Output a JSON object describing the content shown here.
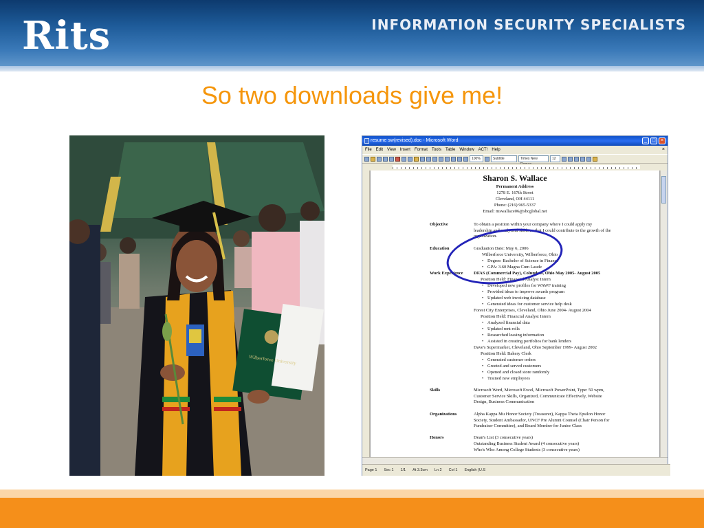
{
  "header": {
    "logo": "Rits",
    "tagline": "INFORMATION SECURITY SPECIALISTS"
  },
  "slide": {
    "title": "So two downloads give me!"
  },
  "photo": {
    "diploma_text": "Wilberforce University"
  },
  "word": {
    "title": "resume sw(revised).doc - Microsoft Word",
    "menu": [
      "File",
      "Edit",
      "View",
      "Insert",
      "Format",
      "Tools",
      "Table",
      "Window",
      "ACT!",
      "Help"
    ],
    "toolbar": {
      "zoom": "100%",
      "style": "Subtitle",
      "font": "Times New Roman",
      "size": "12"
    },
    "status": {
      "page": "Page 1",
      "sec": "Sec 1",
      "pages": "1/1",
      "at": "At 3.3cm",
      "ln": "Ln 2",
      "col": "Col 1",
      "lang": "English (U.S"
    },
    "document": {
      "name": "Sharon S. Wallace",
      "permanent": "Permanent Address",
      "street": "1278 E. 167th Street",
      "city": "Cleveland, OH 44111",
      "phone": "Phone:  (216) 965-5337",
      "email": "Email:  mswallace06@sbcglobal.net",
      "objective_label": "Objective",
      "objective_text": "To obtain a position within your company where I could apply my leadership and analytical skills so that I could contribute to the growth of the organization.",
      "education_label": "Education",
      "education_date": "Graduation Date:  May 6, 2006",
      "education_school": "Wilberforce University, Wilberforce, Ohio",
      "education_bullets": [
        "Degree:  Bachelor of Science in Finance",
        "GPA:  3.60 Magna Cum Laude"
      ],
      "work_label": "Work Experience",
      "job1_header": "DFAS (Commercial Pay), Columbus, Ohio        May 2005- August 2005",
      "job1_position": "Position Held:  Financial Analyst Intern",
      "job1_bullets": [
        "Developed new profiles for WAWF training",
        "Provided ideas to improve awards program",
        "Updated web invoicing database",
        "Generated ideas for customer service help desk"
      ],
      "job2_header": "Forest City Enterprises, Cleveland, Ohio        June 2004- August 2004",
      "job2_position": "Position Held:  Financial Analyst Intern",
      "job2_bullets": [
        "Analyzed financial data",
        "Updated rent rolls",
        "Researched leasing information",
        "Assisted in creating portfolios for bank lenders"
      ],
      "job3_header": "Dave's Supermarket, Cleveland, Ohio     September 1999- August 2002",
      "job3_position": "Position Held:  Bakery Clerk",
      "job3_bullets": [
        "Generated customer orders",
        "Greeted and served customers",
        "Opened and closed store randomly",
        "Trained new employees"
      ],
      "skills_label": "Skills",
      "skills_text": "Microsoft Word, Microsoft Excel, Microsoft PowerPoint, Type: 50 wpm, Customer Service Skills, Organized, Communicate Effectively, Website Design, Business Communication",
      "orgs_label": "Organizations",
      "orgs_text": "Alpha Kappa Mu Honor Society (Treasurer), Kappa Theta Epsilon Honor Society, Student Ambassador, UNCF Pre Alumni Counsel (Chair Person for Fundraiser Committee), and Board Member for Junior Class",
      "honors_label": "Honors",
      "honors_lines": [
        "Dean's List (3 consecutive years)",
        "Outstanding Business Student Award (4 consecutive years)",
        "Who's Who Among College Students (3 consecutive years)"
      ]
    }
  },
  "colors": {
    "title_orange": "#f5960c",
    "footer_orange": "#f58f1a",
    "header_blue": "#1d5a98",
    "circle_blue": "#2324b8"
  }
}
